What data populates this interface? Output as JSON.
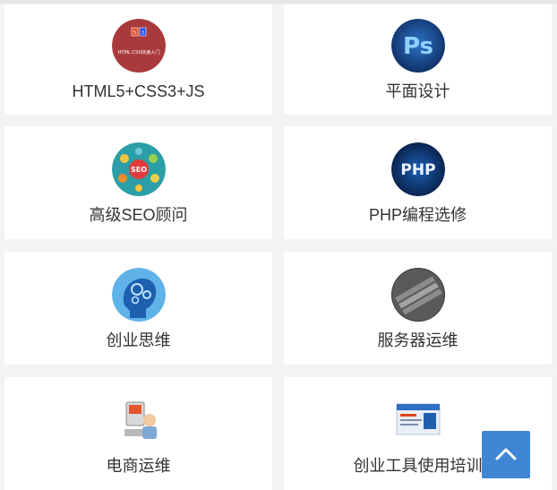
{
  "courses": [
    {
      "label": "HTML5+CSS3+JS",
      "icon": "html5-css3-badge-icon"
    },
    {
      "label": "平面设计",
      "icon": "photoshop-icon"
    },
    {
      "label": "高级SEO顾问",
      "icon": "seo-icon"
    },
    {
      "label": "PHP编程选修",
      "icon": "php-icon"
    },
    {
      "label": "创业思维",
      "icon": "brain-gears-icon"
    },
    {
      "label": "服务器运维",
      "icon": "server-keyboard-icon"
    },
    {
      "label": "电商运维",
      "icon": "ecommerce-support-icon"
    },
    {
      "label": "创业工具使用培训",
      "icon": "startup-tools-icon"
    }
  ],
  "html5_badge_caption": "HTML.CSS快速入门",
  "php_badge_text": "PHP",
  "ps_badge_text": "Ps",
  "seo_badge_text": "SEO",
  "scroll_top": {
    "icon": "chevron-up-icon"
  },
  "colors": {
    "page_bg": "#f3f3f3",
    "card_bg": "#ffffff",
    "label": "#333333",
    "scroll_top_bg": "#3f86d4"
  }
}
